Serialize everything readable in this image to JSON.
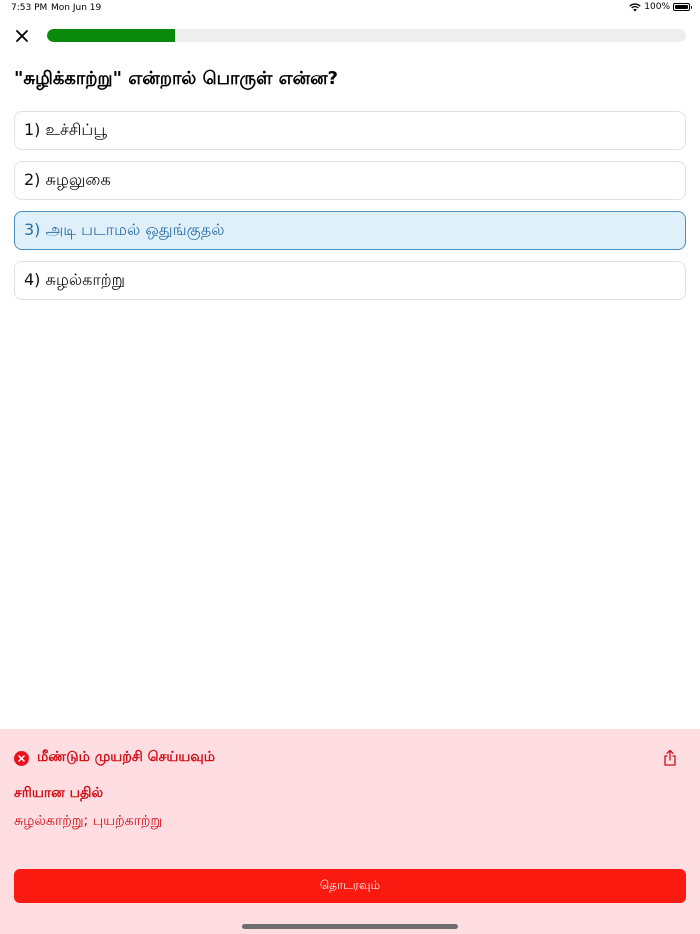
{
  "status_bar": {
    "time": "7:53 PM",
    "date": "Mon Jun 19",
    "battery": "100%"
  },
  "progress": {
    "value": 0.2
  },
  "question": {
    "text": "\"சுழிக்காற்று\" என்றால் பொருள் என்ன?"
  },
  "options": [
    {
      "label": "1) உச்சிப்பூ"
    },
    {
      "label": "2) சுழலுகை"
    },
    {
      "label": "3) அடி படாமல் ஒதுங்குதல்"
    },
    {
      "label": "4) சுழல்காற்று"
    }
  ],
  "selected_option": 3,
  "feedback": {
    "title": "மீண்டும் முயற்சி செய்யவும்",
    "correct_label": "சரியான பதில்",
    "correct_answer": "சுழல்காற்று; புயற்காற்று",
    "continue_label": "தொடரவும்"
  },
  "colors": {
    "progress": "#0a8a0a",
    "selected_bg": "#dff0fb",
    "error": "#d10d16",
    "feedback_bg": "#ffdde0",
    "continue_bg": "#fb1a0f"
  },
  "icons": {
    "close": "close-icon",
    "error": "error-circle-icon",
    "share": "share-icon",
    "wifi": "wifi-icon",
    "battery": "battery-icon"
  }
}
